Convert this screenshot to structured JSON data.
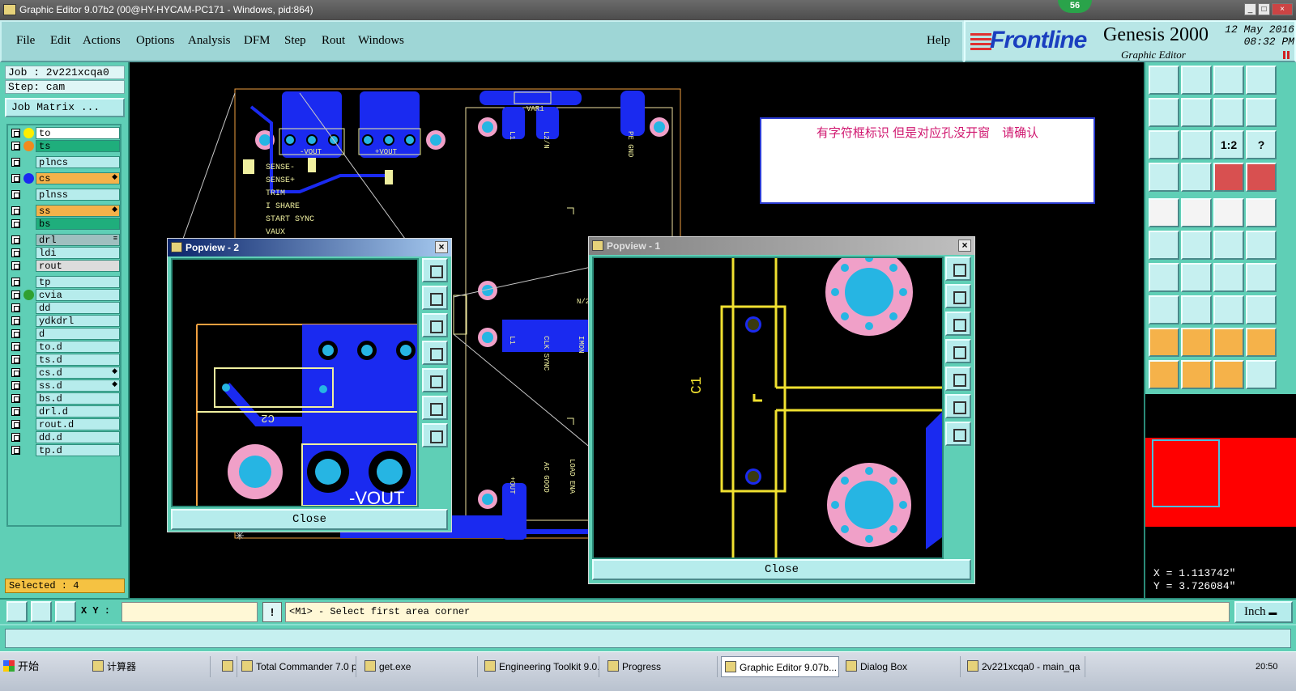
{
  "window": {
    "title": "Graphic Editor 9.07b2 (00@HY-HYCAM-PC171 - Windows, pid:864)",
    "badge": "56",
    "min": "_",
    "max": "□",
    "close": "×"
  },
  "menu": {
    "file": "File",
    "edit": "Edit",
    "actions": "Actions",
    "options": "Options",
    "analysis": "Analysis",
    "dfm": "DFM",
    "step": "Step",
    "rout": "Rout",
    "windows": "Windows",
    "help": "Help"
  },
  "logo": {
    "brand": "Frontline",
    "product": "Genesis 2000",
    "subtitle": "Graphic Editor",
    "date": "12 May 2016",
    "time": "08:32 PM"
  },
  "job": {
    "job_line": "Job : 2v221xcqa0",
    "step_line": "Step: cam",
    "matrix_button": "Job Matrix ..."
  },
  "layers": [
    {
      "name": "to",
      "bg": "#ffffff",
      "dot": "#ffee00"
    },
    {
      "name": "ts",
      "bg": "#1fae7c",
      "dot": "#f28a1e"
    },
    {
      "name": "plncs",
      "bg": "#b6ecec",
      "dot": ""
    },
    {
      "name": "cs",
      "bg": "#f5b24a",
      "dot": "#1a2af0",
      "mark": "◆"
    },
    {
      "name": "plnss",
      "bg": "#b6ecec",
      "dot": ""
    },
    {
      "name": "ss",
      "bg": "#f5b24a",
      "dot": "",
      "mark": "◆"
    },
    {
      "name": "bs",
      "bg": "#1fae7c",
      "dot": ""
    },
    {
      "name": "drl",
      "bg": "#9fbfbf",
      "dot": "",
      "mark": "≡"
    },
    {
      "name": "ldi",
      "bg": "#b6ecec",
      "dot": ""
    },
    {
      "name": "rout",
      "bg": "#dcdcdc",
      "dot": ""
    },
    {
      "name": "tp",
      "bg": "#b6ecec",
      "dot": ""
    },
    {
      "name": "cvia",
      "bg": "#b6ecec",
      "dot": "#30a030"
    },
    {
      "name": "dd",
      "bg": "#b6ecec",
      "dot": ""
    },
    {
      "name": "ydkdrl",
      "bg": "#b6ecec",
      "dot": ""
    },
    {
      "name": "d",
      "bg": "#b6ecec",
      "dot": ""
    },
    {
      "name": "to.d",
      "bg": "#b6ecec",
      "dot": ""
    },
    {
      "name": "ts.d",
      "bg": "#b6ecec",
      "dot": ""
    },
    {
      "name": "cs.d",
      "bg": "#b6ecec",
      "dot": "",
      "mark": "◆"
    },
    {
      "name": "ss.d",
      "bg": "#b6ecec",
      "dot": "",
      "mark": "◆"
    },
    {
      "name": "bs.d",
      "bg": "#b6ecec",
      "dot": ""
    },
    {
      "name": "drl.d",
      "bg": "#b6ecec",
      "dot": ""
    },
    {
      "name": "rout.d",
      "bg": "#b6ecec",
      "dot": ""
    },
    {
      "name": "dd.d",
      "bg": "#b6ecec",
      "dot": ""
    },
    {
      "name": "tp.d",
      "bg": "#b6ecec",
      "dot": ""
    }
  ],
  "selected": "Selected : 4",
  "message": "有字符框标识 但是对应孔没开窗　请确认",
  "board_labels": {
    "neg_vout": "-VOUT",
    "pos_vout": "+VOUT",
    "sense_neg": "SENSE-",
    "sense_pos": "SENSE+",
    "trim": "TRIM",
    "i_share": "I SHARE",
    "start_sync": "START SYNC",
    "vaux": "VAUX",
    "vari": "VAR1",
    "l1": "L1",
    "l2n": "L2/N",
    "pe_gnd": "PE GND",
    "clk_sync": "CLK SYNC",
    "imon": "IMON",
    "lpl1": "L1",
    "ac_good": "AC GOOD",
    "load_ena": "LOAD ENA",
    "out_plus": "+OUT",
    "n2": "N/2"
  },
  "popview2": {
    "title": "Popview - 2",
    "close_label": "Close",
    "ref": "C2",
    "vout": "-VOUT"
  },
  "popview1": {
    "title": "Popview - 1",
    "close_label": "Close",
    "ref": "C1"
  },
  "right_tools": {
    "ratio_label": "1:2",
    "help_label": "?"
  },
  "coords": {
    "x": "X = 1.113742\"",
    "y": "Y = 3.726084\""
  },
  "command": {
    "xy_label": "X Y :",
    "xy_value": "",
    "bang": "!",
    "prompt": "<M1> - Select first area corner",
    "unit": "Inch"
  },
  "taskbar": {
    "start": "开始",
    "tasks": [
      "计算器",
      "",
      "Total Commander 7.0 p...",
      "get.exe",
      "Engineering Toolkit 9.0...",
      "Progress",
      "Graphic Editor 9.07b...",
      "Dialog Box",
      "2v221xcqa0 - main_qa"
    ],
    "clock": "20:50"
  }
}
